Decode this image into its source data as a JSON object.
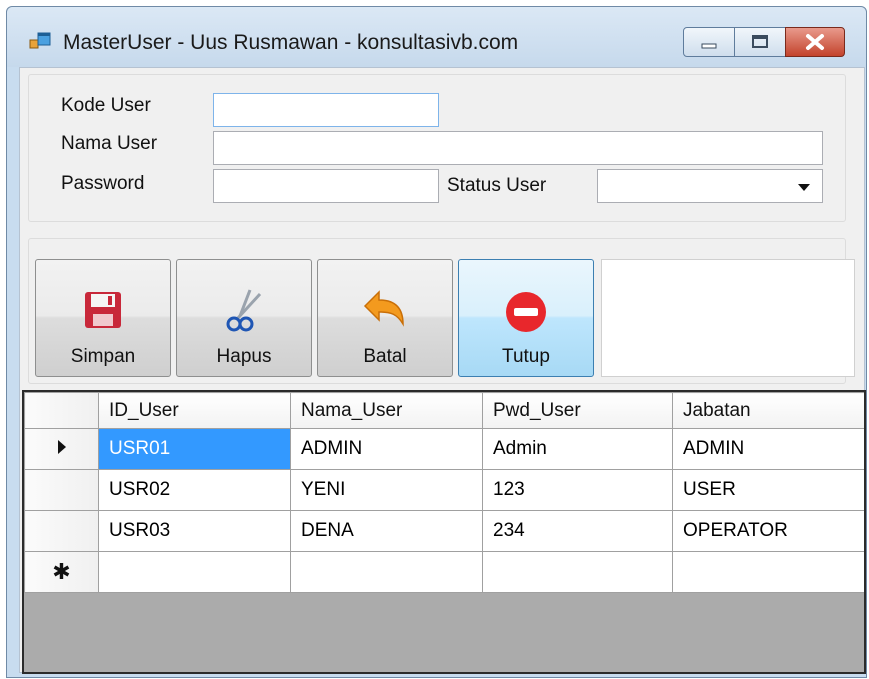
{
  "window": {
    "title": "MasterUser - Uus Rusmawan - konsultasivb.com",
    "controls": [
      "minimize-icon",
      "maximize-icon",
      "close-icon"
    ]
  },
  "form": {
    "kode_user_label": "Kode User",
    "kode_user_value": "",
    "nama_user_label": "Nama User",
    "nama_user_value": "",
    "password_label": "Password",
    "password_value": "",
    "status_user_label": "Status User",
    "status_user_value": ""
  },
  "toolbar": {
    "simpan": {
      "label": "Simpan",
      "icon": "floppy-disk-icon"
    },
    "hapus": {
      "label": "Hapus",
      "icon": "scissors-icon"
    },
    "batal": {
      "label": "Batal",
      "icon": "undo-arrow-icon"
    },
    "tutup": {
      "label": "Tutup",
      "icon": "stop-icon"
    }
  },
  "grid": {
    "columns": [
      "ID_User",
      "Nama_User",
      "Pwd_User",
      "Jabatan"
    ],
    "rows": [
      [
        "USR01",
        "ADMIN",
        "Admin",
        "ADMIN"
      ],
      [
        "USR02",
        "YENI",
        "123",
        "USER"
      ],
      [
        "USR03",
        "DENA",
        "234",
        "OPERATOR"
      ]
    ],
    "current_row_indicator": "row-pointer-icon",
    "new_row_indicator": "new-row-asterisk-icon"
  },
  "colors": {
    "selection": "#3399ff",
    "hot_button": "#bee6fd",
    "close_button": "#c3432c"
  }
}
